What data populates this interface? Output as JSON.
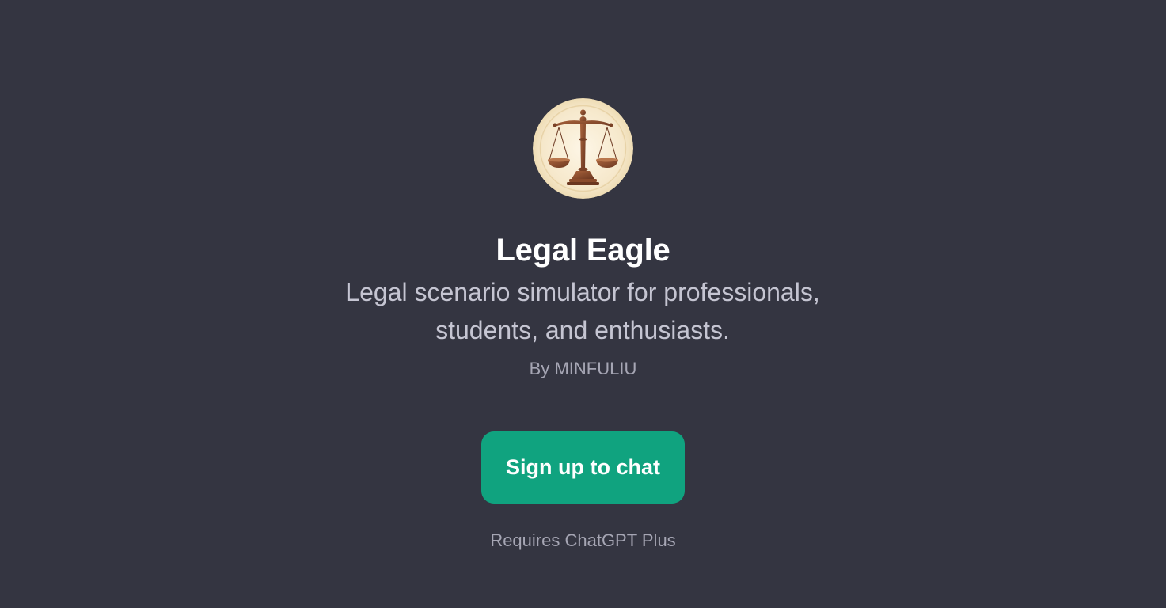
{
  "gpt": {
    "name": "Legal Eagle",
    "description": "Legal scenario simulator for professionals, students, and enthusiasts.",
    "author": "By MINFULIU",
    "avatar_icon": "scales-of-justice-icon"
  },
  "actions": {
    "signup_label": "Sign up to chat"
  },
  "footer": {
    "requirement": "Requires ChatGPT Plus"
  },
  "colors": {
    "background": "#343541",
    "accent": "#10a37f",
    "title": "#ffffff",
    "description": "#c5c5d2",
    "muted": "#a6a6b4",
    "avatar_bg": "#f6e9cf",
    "icon_bronze": "#8a4b2c"
  }
}
